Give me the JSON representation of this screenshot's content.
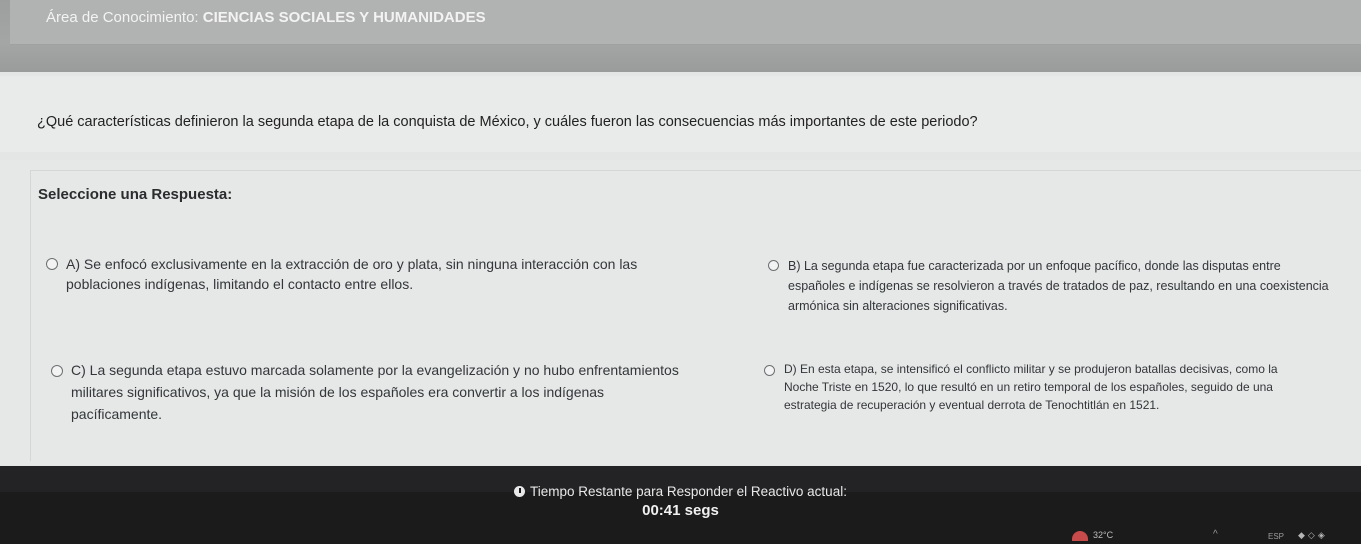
{
  "area": {
    "prefix": "Área de Conocimiento: ",
    "name": "CIENCIAS SOCIALES Y HUMANIDADES"
  },
  "question": {
    "text": "¿Qué características definieron la segunda etapa de la conquista de México, y cuáles fueron las consecuencias más importantes de este periodo?"
  },
  "answers": {
    "prompt": "Seleccione una Respuesta:",
    "options": [
      {
        "id": "A",
        "lines": [
          "A) Se enfocó exclusivamente en la extracción de oro y plata, sin ninguna interacción con las",
          "poblaciones indígenas, limitando el contacto entre ellos."
        ]
      },
      {
        "id": "B",
        "lines": [
          "B) La segunda etapa fue caracterizada por un enfoque pacífico, donde las disputas entre",
          "españoles e indígenas se resolvieron a través de tratados de paz, resultando en una coexistencia",
          "armónica sin alteraciones significativas."
        ]
      },
      {
        "id": "C",
        "lines": [
          "C) La segunda etapa estuvo marcada solamente por la evangelización y no hubo enfrentamientos",
          "militares significativos, ya que la misión de los españoles era convertir a los indígenas",
          "pacíficamente."
        ]
      },
      {
        "id": "D",
        "lines": [
          "D) En esta etapa, se intensificó el conflicto militar y se produjeron batallas decisivas, como la",
          "Noche Triste en 1520, lo que resultó en un retiro temporal de los españoles, seguido de una",
          "estrategia de recuperación y eventual derrota de Tenochtitlán en 1521."
        ]
      }
    ]
  },
  "timer": {
    "label": "Tiempo Restante para Responder el Reactivo actual:",
    "value": "00:41 segs",
    "icon": "clock-icon"
  },
  "taskbar": {
    "temperature": "32°C",
    "language": "ESP"
  }
}
